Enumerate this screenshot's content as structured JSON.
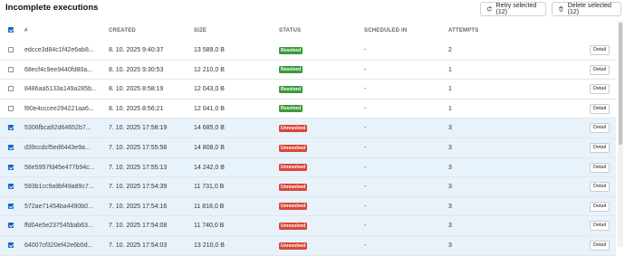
{
  "header": {
    "title": "Incomplete executions",
    "retry_label": "Retry selected (12)",
    "delete_label": "Delete selected (12)"
  },
  "table": {
    "columns": [
      "#",
      "CREATED",
      "SIZE",
      "STATUS",
      "SCHEDULED IN",
      "ATTEMPTS"
    ],
    "detail_label": "Detail",
    "rows": [
      {
        "id": "edcce3d84c1f42e6ab8...",
        "created": "8. 10. 2025 9:40:37",
        "size": "13 589,0 B",
        "status": "Resolved",
        "scheduled": "-",
        "attempts": "2",
        "selected": false
      },
      {
        "id": "68ecf4c9ee9440fd80a...",
        "created": "8. 10. 2025 9:30:53",
        "size": "12 210,0 B",
        "status": "Resolved",
        "scheduled": "-",
        "attempts": "1",
        "selected": false
      },
      {
        "id": "8486aa5133a149a285b...",
        "created": "8. 10. 2025 8:58:19",
        "size": "12 043,0 B",
        "status": "Resolved",
        "scheduled": "-",
        "attempts": "1",
        "selected": false
      },
      {
        "id": "f80e4cccee294221aa6...",
        "created": "8. 10. 2025 8:56:21",
        "size": "12 041,0 B",
        "status": "Resolved",
        "scheduled": "-",
        "attempts": "1",
        "selected": false
      },
      {
        "id": "5306fbca92d64652b7...",
        "created": "7. 10. 2025 17:58:19",
        "size": "14 685,0 B",
        "status": "Unresolved",
        "scheduled": "-",
        "attempts": "3",
        "selected": true
      },
      {
        "id": "d39ccdcf5ed6443e9a...",
        "created": "7. 10. 2025 17:55:58",
        "size": "14 808,0 B",
        "status": "Unresolved",
        "scheduled": "-",
        "attempts": "3",
        "selected": true
      },
      {
        "id": "58e5957fd45e477b94c...",
        "created": "7. 10. 2025 17:55:13",
        "size": "14 242,0 B",
        "status": "Unresolved",
        "scheduled": "-",
        "attempts": "3",
        "selected": true
      },
      {
        "id": "593b1cc9a9bf49a89c7...",
        "created": "7. 10. 2025 17:54:39",
        "size": "11 731,0 B",
        "status": "Unresolved",
        "scheduled": "-",
        "attempts": "3",
        "selected": true
      },
      {
        "id": "572ae71454ba4490b0...",
        "created": "7. 10. 2025 17:54:16",
        "size": "11 818,0 B",
        "status": "Unresolved",
        "scheduled": "-",
        "attempts": "3",
        "selected": true
      },
      {
        "id": "ffd04e5e237545bab63...",
        "created": "7. 10. 2025 17:54:08",
        "size": "11 740,0 B",
        "status": "Unresolved",
        "scheduled": "-",
        "attempts": "3",
        "selected": true
      },
      {
        "id": "64007cf320ef42e6b5d...",
        "created": "7. 10. 2025 17:54:03",
        "size": "13 210,0 B",
        "status": "Unresolved",
        "scheduled": "-",
        "attempts": "3",
        "selected": true
      }
    ]
  },
  "colors": {
    "resolved": "#3c9a3c",
    "unresolved": "#d9473a",
    "selected_row": "#e8f2fb",
    "checkbox_accent": "#1565c0"
  },
  "icons": {
    "retry": "refresh-icon",
    "delete": "trash-icon"
  }
}
